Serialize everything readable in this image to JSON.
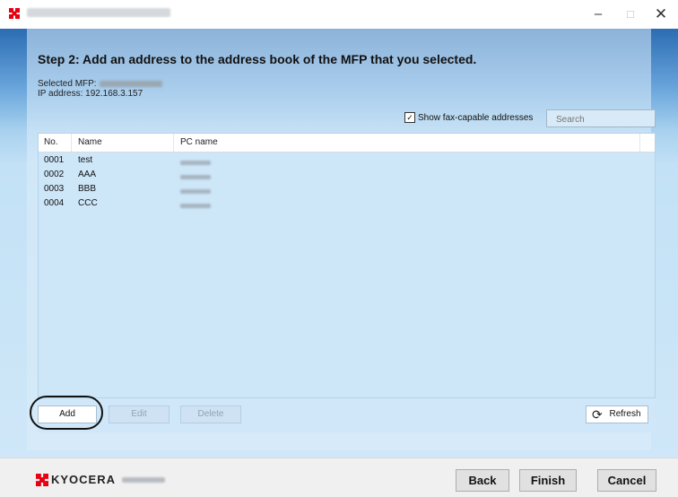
{
  "window": {
    "controls": {
      "minimize": "–",
      "maximize": "□",
      "close": "✕"
    }
  },
  "step_title": "Step 2: Add an address to the address book of the MFP that you selected.",
  "selected_mfp_label": "Selected MFP:",
  "ip_address_label": "IP address: 192.168.3.157",
  "show_fax_label": "Show fax-capable addresses",
  "show_fax_checked": true,
  "search_placeholder": "Search",
  "table": {
    "columns": [
      "No.",
      "Name",
      "PC name"
    ],
    "rows": [
      {
        "no": "0001",
        "name": "test"
      },
      {
        "no": "0002",
        "name": "AAA"
      },
      {
        "no": "0003",
        "name": "BBB"
      },
      {
        "no": "0004",
        "name": "CCC"
      }
    ]
  },
  "actions": {
    "add": "Add",
    "edit": "Edit",
    "delete": "Delete",
    "refresh": "Refresh"
  },
  "footer": {
    "brand": "KYOCERA",
    "back": "Back",
    "finish": "Finish",
    "cancel": "Cancel"
  },
  "colors": {
    "brand_red": "#e60012",
    "panel_blue": "#cfe7f8",
    "header_blue": "#2b6cb3"
  },
  "icons": {
    "app": "kyocera-logo-icon",
    "refresh": "refresh-icon",
    "checkbox": "checkmark-icon"
  }
}
